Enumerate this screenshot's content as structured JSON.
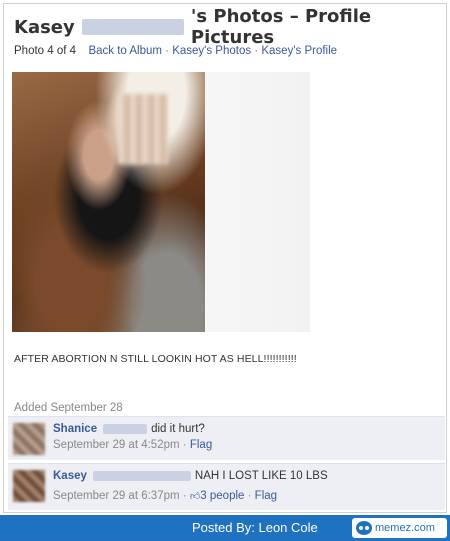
{
  "header": {
    "name_first": "Kasey",
    "title_suffix": "'s Photos – Profile Pictures"
  },
  "subnav": {
    "photo_count": "Photo 4 of 4",
    "back_to_album": "Back to Album",
    "separator": "·",
    "photos_link": "Kasey's Photos",
    "profile_link": "Kasey's Profile"
  },
  "caption": "AFTER ABORTION N STILL LOOKIN HOT AS HELL!!!!!!!!!!!",
  "added": "Added September 28",
  "comments": [
    {
      "name": "Shanice",
      "text": "did it hurt?",
      "time": "September 29 at 4:52pm",
      "sep": "·",
      "flag": "Flag"
    },
    {
      "name": "Kasey",
      "text": "NAH I LOST LIKE 10 LBS",
      "time": "September 29 at 6:37pm",
      "sep": "·",
      "likes": "3 people",
      "flag": "Flag"
    }
  ],
  "footer": {
    "posted_by": "Posted By: Leon Cole",
    "brand": "memez.com"
  },
  "colors": {
    "link": "#3b5998",
    "footer_bg": "#1f72bf",
    "comment_bg": "#edeff4"
  },
  "icons": {
    "like": "thumbs-up-icon",
    "brand": "memez-logo-icon"
  }
}
